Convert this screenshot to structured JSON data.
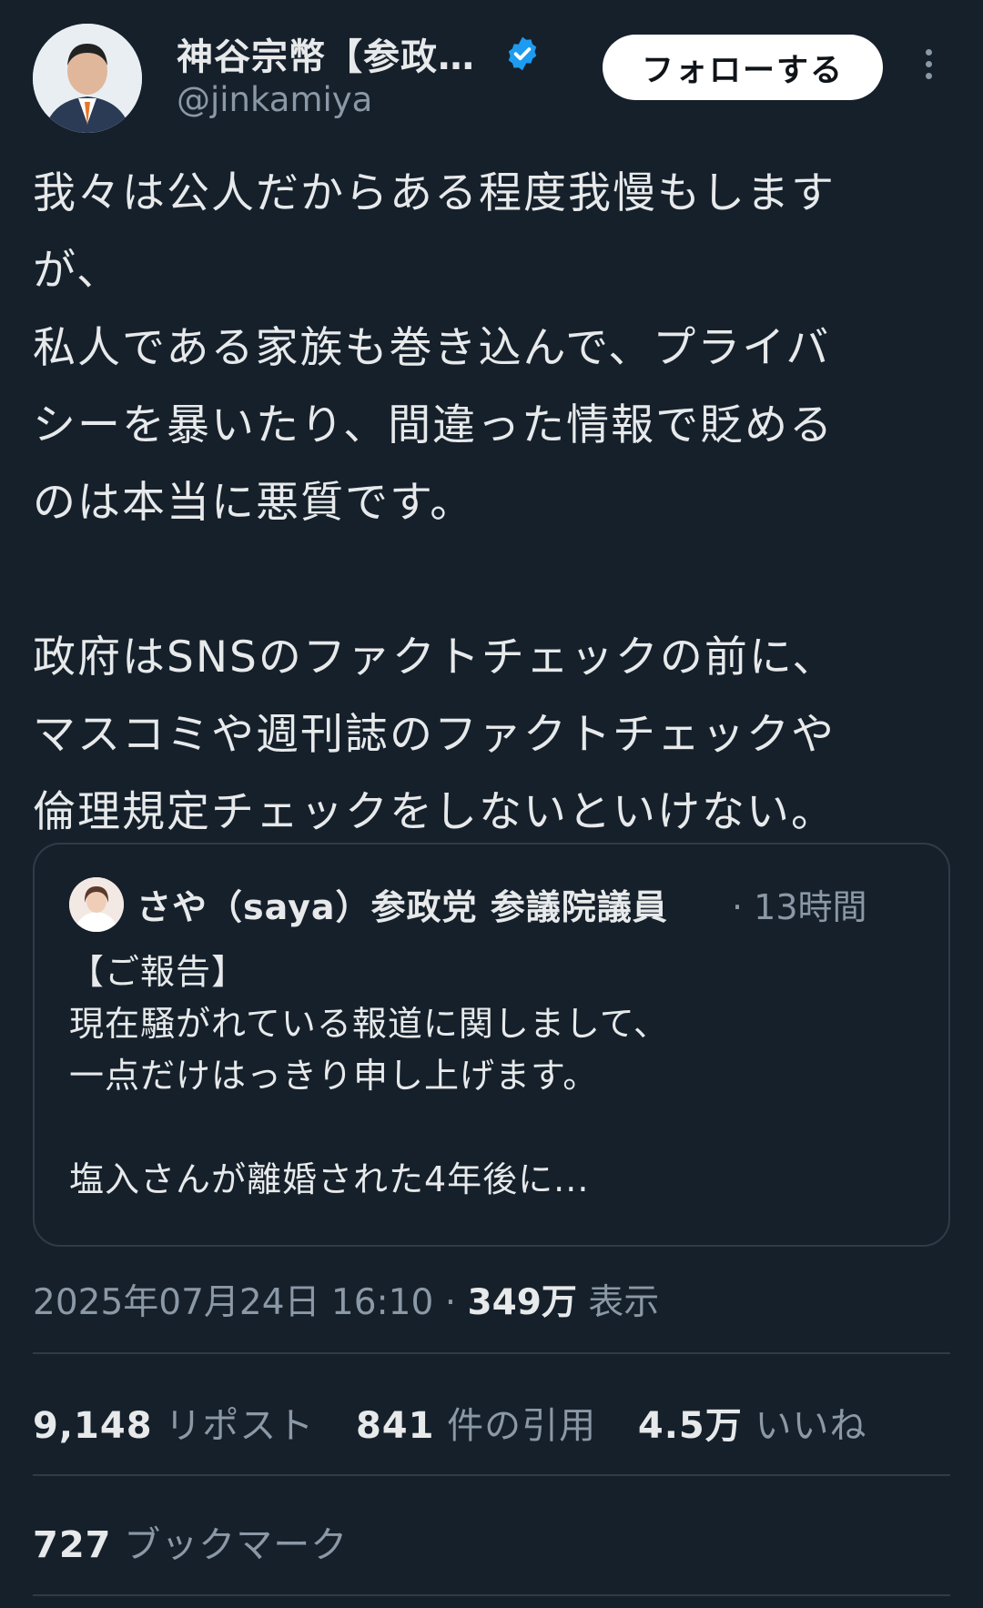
{
  "author": {
    "name": "神谷宗幣【参政…",
    "handle": "@jinkamiya",
    "verified_icon": "verified-badge-icon",
    "verified_color": "#1d9bf0"
  },
  "actions": {
    "follow_label": "フォローする",
    "more_icon": "more-vertical-icon"
  },
  "tweet": {
    "lines": [
      "我々は公人だからある程度我慢もします",
      "が、",
      "私人である家族も巻き込んで、プライバ",
      "シーを暴いたり、間違った情報で貶める",
      "のは本当に悪質です。",
      "",
      "政府はSNSのファクトチェックの前に、",
      "マスコミや週刊誌のファクトチェックや",
      "倫理規定チェックをしないといけない。"
    ]
  },
  "quote": {
    "name": "さや（saya）参政党 参議院議員",
    "time": "· 13時間",
    "lines": [
      "【ご報告】",
      "現在騒がれている報道に関しまして、",
      "一点だけはっきり申し上げます。",
      "",
      "塩入さんが離婚された4年後に..."
    ]
  },
  "meta": {
    "timestamp": "2025年07月24日 16:10 · ",
    "views_value": "349万",
    "views_label": " 表示"
  },
  "stats": {
    "reposts_value": "9,148",
    "reposts_label": " リポスト",
    "quotes_value": "841",
    "quotes_label": " 件の引用",
    "likes_value": "4.5万",
    "likes_label": " いいね",
    "bookmarks_value": "727",
    "bookmarks_label": " ブックマーク"
  },
  "colors": {
    "background": "#15202b",
    "text": "#e7e9ea",
    "secondary": "#8b98a5",
    "border": "#2f3b47"
  }
}
